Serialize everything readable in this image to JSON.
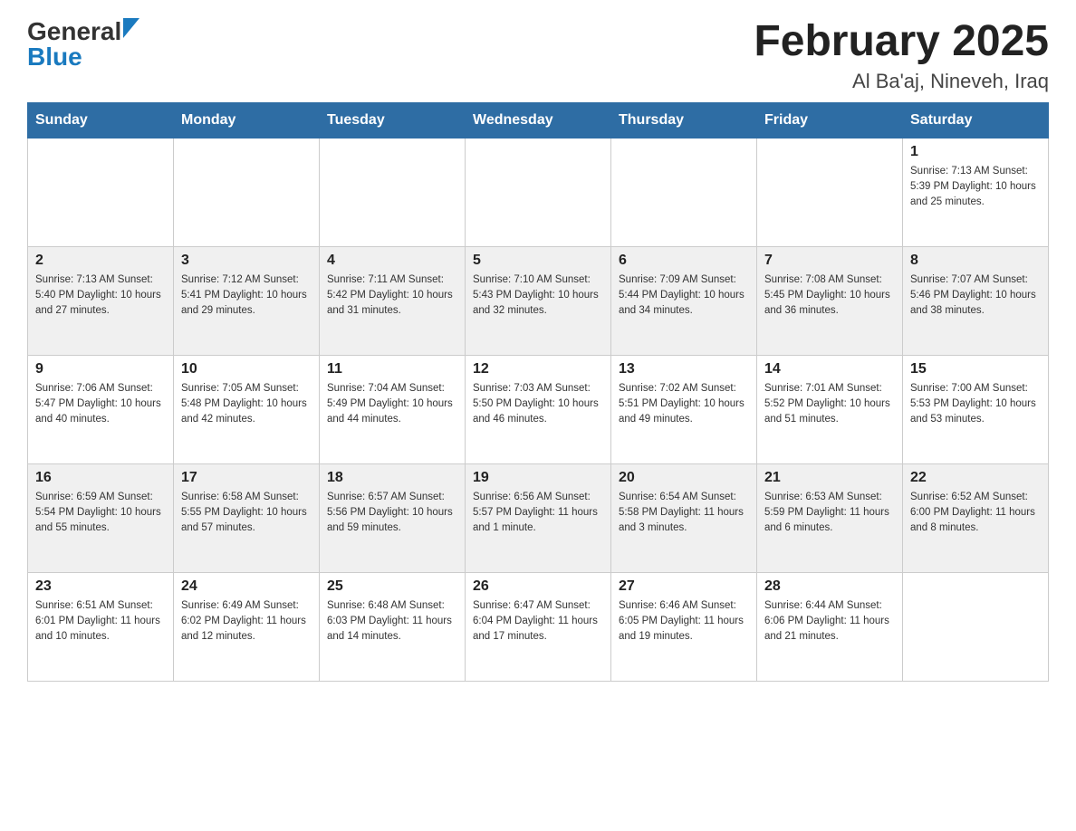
{
  "header": {
    "logo_general": "General",
    "logo_blue": "Blue",
    "month_title": "February 2025",
    "location": "Al Ba'aj, Nineveh, Iraq"
  },
  "days_of_week": [
    "Sunday",
    "Monday",
    "Tuesday",
    "Wednesday",
    "Thursday",
    "Friday",
    "Saturday"
  ],
  "weeks": [
    [
      {
        "day": "",
        "info": ""
      },
      {
        "day": "",
        "info": ""
      },
      {
        "day": "",
        "info": ""
      },
      {
        "day": "",
        "info": ""
      },
      {
        "day": "",
        "info": ""
      },
      {
        "day": "",
        "info": ""
      },
      {
        "day": "1",
        "info": "Sunrise: 7:13 AM\nSunset: 5:39 PM\nDaylight: 10 hours and 25 minutes."
      }
    ],
    [
      {
        "day": "2",
        "info": "Sunrise: 7:13 AM\nSunset: 5:40 PM\nDaylight: 10 hours and 27 minutes."
      },
      {
        "day": "3",
        "info": "Sunrise: 7:12 AM\nSunset: 5:41 PM\nDaylight: 10 hours and 29 minutes."
      },
      {
        "day": "4",
        "info": "Sunrise: 7:11 AM\nSunset: 5:42 PM\nDaylight: 10 hours and 31 minutes."
      },
      {
        "day": "5",
        "info": "Sunrise: 7:10 AM\nSunset: 5:43 PM\nDaylight: 10 hours and 32 minutes."
      },
      {
        "day": "6",
        "info": "Sunrise: 7:09 AM\nSunset: 5:44 PM\nDaylight: 10 hours and 34 minutes."
      },
      {
        "day": "7",
        "info": "Sunrise: 7:08 AM\nSunset: 5:45 PM\nDaylight: 10 hours and 36 minutes."
      },
      {
        "day": "8",
        "info": "Sunrise: 7:07 AM\nSunset: 5:46 PM\nDaylight: 10 hours and 38 minutes."
      }
    ],
    [
      {
        "day": "9",
        "info": "Sunrise: 7:06 AM\nSunset: 5:47 PM\nDaylight: 10 hours and 40 minutes."
      },
      {
        "day": "10",
        "info": "Sunrise: 7:05 AM\nSunset: 5:48 PM\nDaylight: 10 hours and 42 minutes."
      },
      {
        "day": "11",
        "info": "Sunrise: 7:04 AM\nSunset: 5:49 PM\nDaylight: 10 hours and 44 minutes."
      },
      {
        "day": "12",
        "info": "Sunrise: 7:03 AM\nSunset: 5:50 PM\nDaylight: 10 hours and 46 minutes."
      },
      {
        "day": "13",
        "info": "Sunrise: 7:02 AM\nSunset: 5:51 PM\nDaylight: 10 hours and 49 minutes."
      },
      {
        "day": "14",
        "info": "Sunrise: 7:01 AM\nSunset: 5:52 PM\nDaylight: 10 hours and 51 minutes."
      },
      {
        "day": "15",
        "info": "Sunrise: 7:00 AM\nSunset: 5:53 PM\nDaylight: 10 hours and 53 minutes."
      }
    ],
    [
      {
        "day": "16",
        "info": "Sunrise: 6:59 AM\nSunset: 5:54 PM\nDaylight: 10 hours and 55 minutes."
      },
      {
        "day": "17",
        "info": "Sunrise: 6:58 AM\nSunset: 5:55 PM\nDaylight: 10 hours and 57 minutes."
      },
      {
        "day": "18",
        "info": "Sunrise: 6:57 AM\nSunset: 5:56 PM\nDaylight: 10 hours and 59 minutes."
      },
      {
        "day": "19",
        "info": "Sunrise: 6:56 AM\nSunset: 5:57 PM\nDaylight: 11 hours and 1 minute."
      },
      {
        "day": "20",
        "info": "Sunrise: 6:54 AM\nSunset: 5:58 PM\nDaylight: 11 hours and 3 minutes."
      },
      {
        "day": "21",
        "info": "Sunrise: 6:53 AM\nSunset: 5:59 PM\nDaylight: 11 hours and 6 minutes."
      },
      {
        "day": "22",
        "info": "Sunrise: 6:52 AM\nSunset: 6:00 PM\nDaylight: 11 hours and 8 minutes."
      }
    ],
    [
      {
        "day": "23",
        "info": "Sunrise: 6:51 AM\nSunset: 6:01 PM\nDaylight: 11 hours and 10 minutes."
      },
      {
        "day": "24",
        "info": "Sunrise: 6:49 AM\nSunset: 6:02 PM\nDaylight: 11 hours and 12 minutes."
      },
      {
        "day": "25",
        "info": "Sunrise: 6:48 AM\nSunset: 6:03 PM\nDaylight: 11 hours and 14 minutes."
      },
      {
        "day": "26",
        "info": "Sunrise: 6:47 AM\nSunset: 6:04 PM\nDaylight: 11 hours and 17 minutes."
      },
      {
        "day": "27",
        "info": "Sunrise: 6:46 AM\nSunset: 6:05 PM\nDaylight: 11 hours and 19 minutes."
      },
      {
        "day": "28",
        "info": "Sunrise: 6:44 AM\nSunset: 6:06 PM\nDaylight: 11 hours and 21 minutes."
      },
      {
        "day": "",
        "info": ""
      }
    ]
  ]
}
